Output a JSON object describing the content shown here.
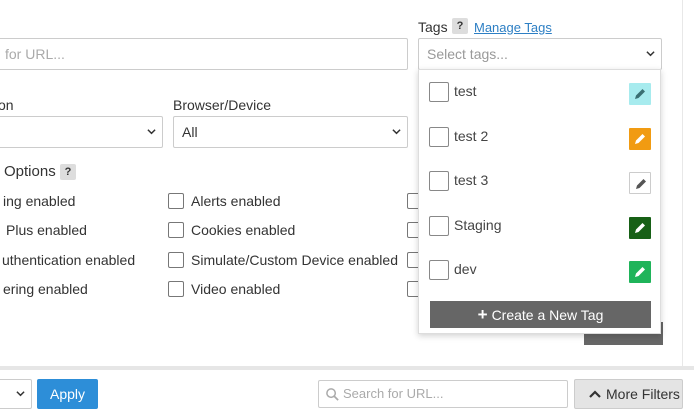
{
  "tags": {
    "label": "Tags",
    "help": "?",
    "manage_link": "Manage Tags",
    "placeholder": "Select tags...",
    "items": [
      {
        "label": "test",
        "color": "#a7ebee",
        "icon": "pencil-icon",
        "icon_color": "#3a6f72"
      },
      {
        "label": "test 2",
        "color": "#f19b12",
        "icon": "pencil-icon",
        "icon_color": "#ffffff"
      },
      {
        "label": "test 3",
        "color": "#ffffff",
        "icon": "pencil-icon",
        "icon_color": "#555555"
      },
      {
        "label": "Staging",
        "color": "#176016",
        "icon": "pencil-icon",
        "icon_color": "#ffffff"
      },
      {
        "label": "dev",
        "color": "#1fb45a",
        "icon": "pencil-icon",
        "icon_color": "#ffffff"
      }
    ],
    "create_label": "Create a New Tag"
  },
  "url_search": {
    "placeholder": "for URL..."
  },
  "location": {
    "label": "on"
  },
  "browser_device": {
    "label": "Browser/Device",
    "value": "All"
  },
  "options": {
    "title": "Options",
    "help": "?",
    "col1": [
      "ing enabled",
      "Plus enabled",
      "uthentication enabled",
      "ering enabled"
    ],
    "col2": [
      "Alerts enabled",
      "Cookies enabled",
      "Simulate/Custom Device enabled",
      "Video enabled"
    ]
  },
  "bottom": {
    "apply_label": "Apply",
    "search_placeholder": "Search for URL...",
    "more_filters_label": "More Filters"
  },
  "colors": {
    "accent": "#2d8ed8",
    "create_button": "#666666"
  }
}
